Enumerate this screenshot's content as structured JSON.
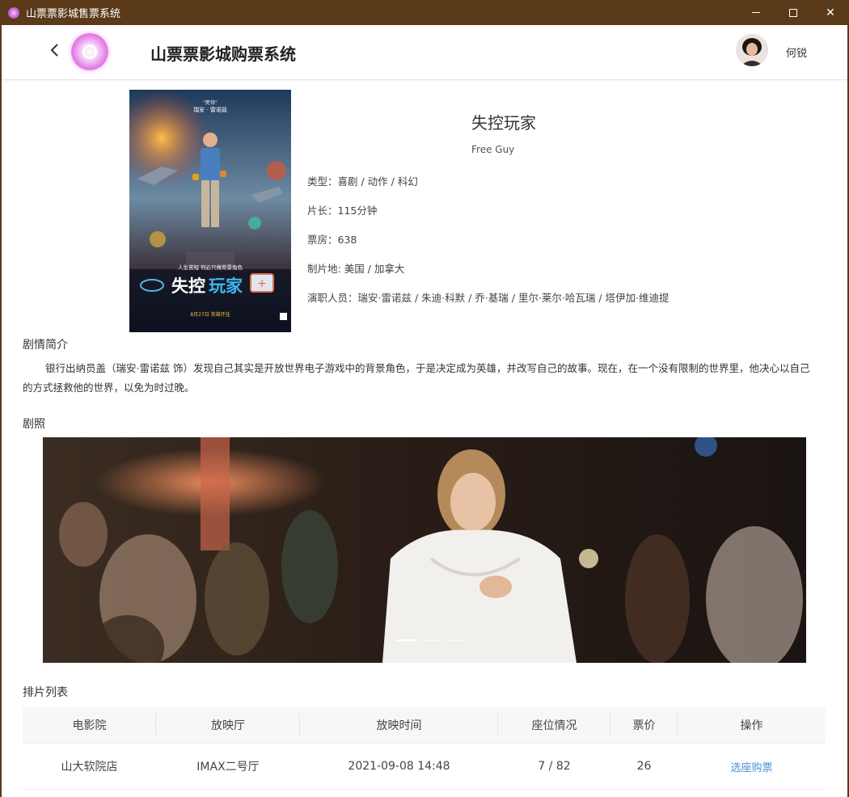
{
  "window": {
    "title": "山票票影城售票系统"
  },
  "header": {
    "app_title": "山票票影城购票系统",
    "username": "何锐"
  },
  "movie": {
    "title": "失控玩家",
    "english_title": "Free Guy",
    "info": [
      {
        "label": "类型：",
        "value": "喜剧 / 动作 / 科幻"
      },
      {
        "label": "片长：",
        "value": "115分钟"
      },
      {
        "label": "票房：",
        "value": "638"
      },
      {
        "label": "制片地: ",
        "value": "美国 / 加拿大"
      },
      {
        "label": "演职人员：",
        "value": "瑞安·雷诺兹 / 朱迪·科默 / 乔·基瑞 / 里尔·莱尔·哈瓦瑞 / 塔伊加·维迪提"
      }
    ],
    "poster": {
      "top_text": "瑞安 · 雷诺兹",
      "tagline": "人生苦短   何必只做背景角色",
      "title_a": "失控",
      "title_b": "玩家",
      "release": "8月27日 英雄开挂"
    }
  },
  "synopsis": {
    "heading": "剧情简介",
    "text": "银行出纳员盖（瑞安·雷诺兹 饰）发现自己其实是开放世界电子游戏中的背景角色，于是决定成为英雄，并改写自己的故事。现在，在一个没有限制的世界里，他决心以自己的方式拯救他的世界，以免为时过晚。"
  },
  "stills": {
    "heading": "剧照",
    "slide_count": 3,
    "active_index": 0
  },
  "schedule": {
    "heading": "排片列表",
    "columns": [
      "电影院",
      "放映厅",
      "放映时间",
      "座位情况",
      "票价",
      "操作"
    ],
    "rows": [
      {
        "cinema": "山大软院店",
        "hall": "IMAX二号厅",
        "time": "2021-09-08 14:48",
        "seats": "7 / 82",
        "price": "26",
        "action": "选座购票"
      }
    ]
  },
  "colors": {
    "titlebar": "#5b3a1a",
    "link": "#4a90d9",
    "accent": "#e27ae6"
  }
}
